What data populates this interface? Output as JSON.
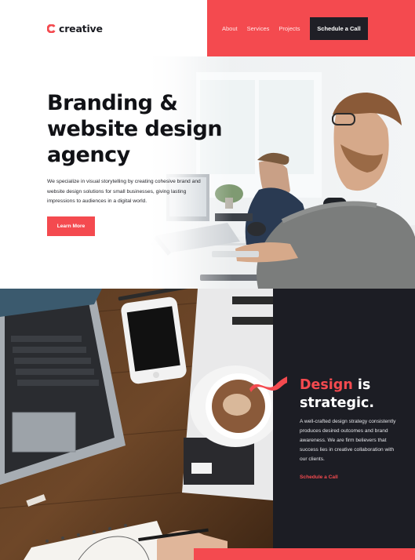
{
  "brand": {
    "logo_text": "creative",
    "logo_icon": "c-logo-icon",
    "accent_color": "#f44a4f",
    "dark_color": "#1c1d24"
  },
  "nav": {
    "items": [
      {
        "label": "About"
      },
      {
        "label": "Services"
      },
      {
        "label": "Projects"
      }
    ],
    "cta_label": "Schedule a Call"
  },
  "hero": {
    "title": "Branding & website design agency",
    "description": "We specialize in visual storytelling by creating cohesive brand and website design solutions for small businesses, giving lasting impressions to audiences in a digital world.",
    "button_label": "Learn More"
  },
  "strategy": {
    "title_accent": "Design",
    "title_rest": " is strategic.",
    "text": "A well-crafted design strategy consistently produces desired outcomes and brand awareness. We are firm believers that success lies in creative collaboration with our clients.",
    "link_label": "Schedule a Call"
  }
}
